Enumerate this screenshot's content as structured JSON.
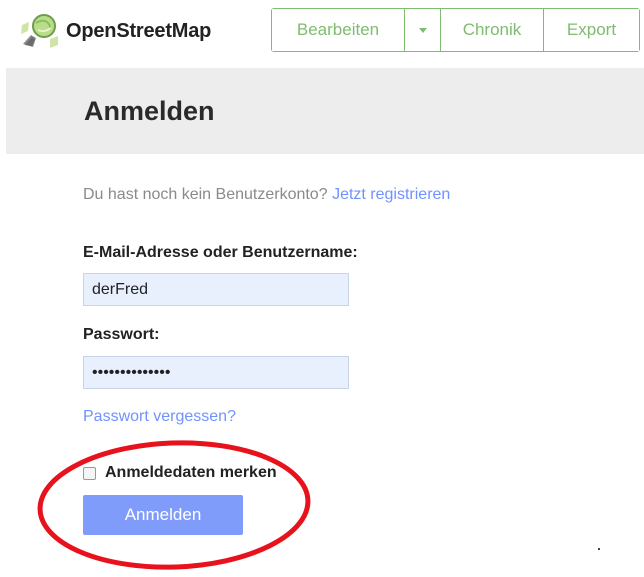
{
  "brand": {
    "name": "OpenStreetMap",
    "logo_icon": "osm-magnifier-logo-icon"
  },
  "nav": {
    "edit_label": "Bearbeiten",
    "dropdown_icon": "caret-down-icon",
    "history_label": "Chronik",
    "export_label": "Export"
  },
  "page": {
    "title": "Anmelden"
  },
  "form": {
    "signup_prompt": "Du hast noch kein Benutzerkonto?",
    "signup_link": "Jetzt registrieren",
    "username_label": "E-Mail-Adresse oder Benutzername:",
    "username_value": "derFred",
    "password_label": "Passwort:",
    "password_value": "••••••••••••••",
    "forgot_link": "Passwort vergessen?",
    "remember_label": "Anmeldedaten merken",
    "remember_checked": false,
    "submit_label": "Anmelden"
  },
  "colors": {
    "accent_green": "#7ebc6f",
    "link_blue": "#7092ff",
    "button_blue": "#7f9cfb",
    "annotation_red": "#e8121c",
    "heading_band": "#ededed"
  }
}
